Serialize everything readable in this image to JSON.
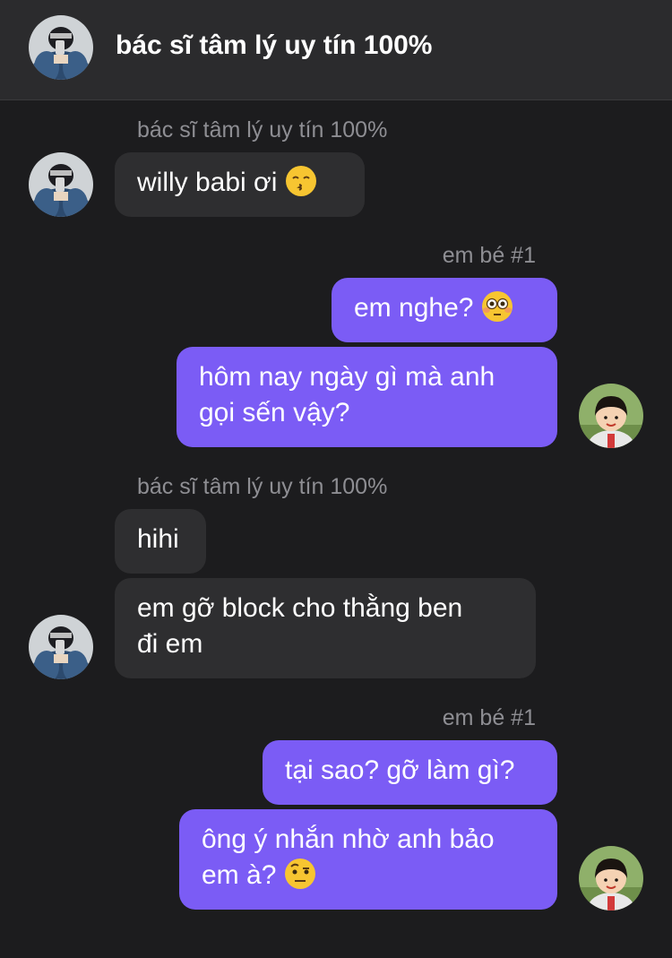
{
  "header": {
    "title": "bác sĩ tâm lý uy tín 100%",
    "avatar_icon": "user-photo-dark-jacket"
  },
  "groups": [
    {
      "sender": "bác sĩ tâm lý uy tín 100%",
      "direction": "incoming",
      "messages": [
        {
          "text": "willy babi ơi",
          "emoji": "kissing-face"
        }
      ]
    },
    {
      "sender": "em bé #1",
      "direction": "outgoing",
      "messages": [
        {
          "text": "em nghe?",
          "emoji": "flushed-face"
        },
        {
          "text_line1": "hôm nay ngày gì mà anh",
          "text_line2": "gọi sến vậy?"
        }
      ]
    },
    {
      "sender": "bác sĩ tâm lý uy tín 100%",
      "direction": "incoming",
      "messages": [
        {
          "text": "hihi"
        },
        {
          "text_line1": "em gỡ block cho thằng ben",
          "text_line2": "đi em"
        }
      ]
    },
    {
      "sender": "em bé #1",
      "direction": "outgoing",
      "messages": [
        {
          "text": "tại sao? gỡ làm gì?"
        },
        {
          "text_line1": "ông ý nhắn nhờ anh bảo",
          "text_line2": "em à?",
          "emoji": "raised-eyebrow-face"
        }
      ]
    }
  ],
  "colors": {
    "background": "#1c1c1e",
    "header": "#2b2b2d",
    "incoming_bubble": "#2e2e30",
    "outgoing_bubble": "#7b5cf5",
    "sender_name": "#8e8e93"
  }
}
